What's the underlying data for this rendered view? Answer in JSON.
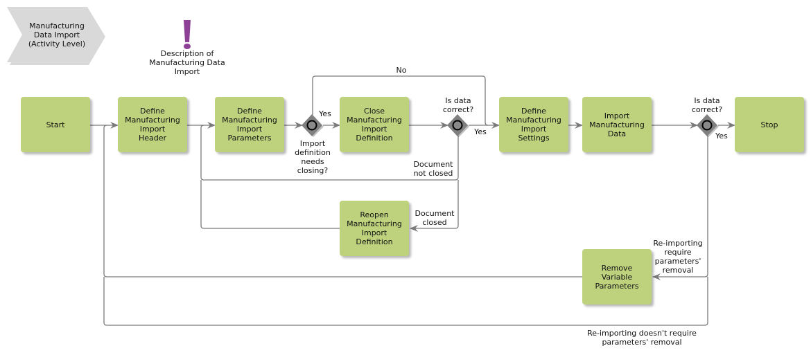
{
  "header": {
    "process_title": "Manufacturing\nData Import\n(Activity Level)",
    "annotation_icon": "exclamation-icon",
    "annotation_label": "Description of\nManufacturing Data\nImport"
  },
  "colors": {
    "activity_fill": "#bed27e",
    "title_fill": "#d9d9d9",
    "annotation": "#8e3f96",
    "gateway_fill": "#808080",
    "connector": "#7a7a7a"
  },
  "activities": {
    "start": "Start",
    "define_header": "Define\nManufacturing\nImport\nHeader",
    "define_parameters": "Define\nManufacturing\nImport\nParameters",
    "close_definition": "Close\nManufacturing\nImport\nDefinition",
    "reopen_definition": "Reopen\nManufacturing\nImport\nDefinition",
    "define_settings": "Define\nManufacturing\nImport\nSettings",
    "import_data": "Import\nManufacturing\nData",
    "remove_parameters": "Remove\nVariable\nParameters",
    "stop": "Stop"
  },
  "gateways": {
    "needs_closing": "Import\ndefinition\nneeds\nclosing?",
    "data_correct_1": "Is data\ncorrect?",
    "data_correct_2": "Is data\ncorrect?"
  },
  "edge_labels": {
    "yes_1": "Yes",
    "no_1": "No",
    "yes_2": "Yes",
    "yes_3": "Yes",
    "doc_not_closed": "Document\nnot closed",
    "doc_closed": "Document\nclosed",
    "reimport_require": "Re-importing\nrequire\nparameters'\nremoval",
    "reimport_no_require": "Re-importing doesn't require\nparameters' removal"
  }
}
